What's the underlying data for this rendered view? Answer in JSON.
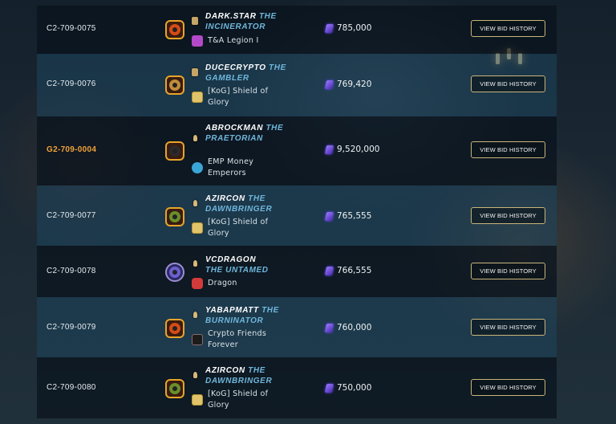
{
  "bids": [
    {
      "item_id": "C2-709-0075",
      "player": "DARK.STAR",
      "title": "THE INCINERATOR",
      "guild": "T&A Legion I",
      "guild_icon": "purple-banner-icon",
      "amount": "785,000",
      "button": "VIEW BID HISTORY",
      "highlight": false
    },
    {
      "item_id": "C2-709-0076",
      "player": "DUCECRYPTO",
      "title": "THE GAMBLER",
      "guild": "[KoG] Shield of Glory",
      "guild_icon": "gold-shield-icon",
      "amount": "769,420",
      "button": "VIEW BID HISTORY",
      "highlight": false
    },
    {
      "item_id": "G2-709-0004",
      "player": "ABROCKMAN",
      "title": "THE PRAETORIAN",
      "guild": "EMP Money Emperors",
      "guild_icon": "blue-orb-icon",
      "amount": "9,520,000",
      "button": "VIEW BID HISTORY",
      "highlight": true
    },
    {
      "item_id": "C2-709-0077",
      "player": "AZIRCON",
      "title": "THE DAWNBRINGER",
      "guild": "[KoG] Shield of Glory",
      "guild_icon": "gold-shield-icon",
      "amount": "765,555",
      "button": "VIEW BID HISTORY",
      "highlight": false
    },
    {
      "item_id": "C2-709-0078",
      "player": "VCDRAGON",
      "title": "THE UNTAMED",
      "guild": "Dragon",
      "guild_icon": "red-dragon-icon",
      "amount": "766,555",
      "button": "VIEW BID HISTORY",
      "highlight": false
    },
    {
      "item_id": "C2-709-0079",
      "player": "YABAPMATT",
      "title": "THE BURNINATOR",
      "guild": "Crypto Friends Forever",
      "guild_icon": "dark-banner-icon",
      "amount": "760,000",
      "button": "VIEW BID HISTORY",
      "highlight": false
    },
    {
      "item_id": "C2-709-0080",
      "player": "AZIRCON",
      "title": "THE DAWNBRINGER",
      "guild": "[KoG] Shield of Glory",
      "guild_icon": "gold-shield-icon",
      "amount": "750,000",
      "button": "VIEW BID HISTORY",
      "highlight": false
    }
  ],
  "colors": {
    "highlight_id": "#f0a23a",
    "title_text": "#6fb7dc",
    "button_border": "#c9b57a",
    "currency_gem": "#7a5bff"
  },
  "currency_icon": "dec-gem-icon"
}
